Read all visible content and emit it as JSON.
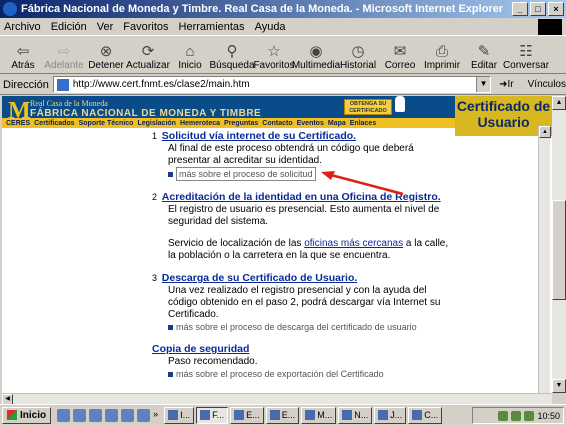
{
  "window": {
    "title": "Fábrica Nacional de Moneda y Timbre. Real Casa de la Moneda. - Microsoft Internet Explorer",
    "controls": [
      "_",
      "□",
      "×"
    ]
  },
  "menu": [
    "Archivo",
    "Edición",
    "Ver",
    "Favoritos",
    "Herramientas",
    "Ayuda"
  ],
  "toolbar": [
    {
      "label": "Atrás",
      "icon": "back-arrow-icon",
      "glyph": "⇦",
      "disabled": false
    },
    {
      "label": "Adelante",
      "icon": "forward-arrow-icon",
      "glyph": "⇨",
      "disabled": true
    },
    {
      "label": "Detener",
      "icon": "stop-icon",
      "glyph": "⊗",
      "disabled": false
    },
    {
      "label": "Actualizar",
      "icon": "refresh-icon",
      "glyph": "⟳",
      "disabled": false
    },
    {
      "label": "Inicio",
      "icon": "home-icon",
      "glyph": "⌂",
      "disabled": false
    },
    {
      "label": "Búsqueda",
      "icon": "search-icon",
      "glyph": "⚲",
      "disabled": false
    },
    {
      "label": "Favoritos",
      "icon": "favorites-icon",
      "glyph": "☆",
      "disabled": false
    },
    {
      "label": "Multimedia",
      "icon": "multimedia-icon",
      "glyph": "◉",
      "disabled": false
    },
    {
      "label": "Historial",
      "icon": "history-icon",
      "glyph": "◷",
      "disabled": false
    },
    {
      "label": "Correo",
      "icon": "mail-icon",
      "glyph": "✉",
      "disabled": false
    },
    {
      "label": "Imprimir",
      "icon": "print-icon",
      "glyph": "⎙",
      "disabled": false
    },
    {
      "label": "Editar",
      "icon": "edit-icon",
      "glyph": "✎",
      "disabled": false
    },
    {
      "label": "Conversar",
      "icon": "discuss-icon",
      "glyph": "☷",
      "disabled": false
    }
  ],
  "address": {
    "label": "Dirección",
    "url": "http://www.cert.fnmt.es/clase2/main.htm",
    "go_label": "Ir",
    "links_label": "Vínculos"
  },
  "banner": {
    "line1": "Real Casa de la Moneda",
    "line2": "FÁBRICA NACIONAL DE MONEDA Y TIMBRE",
    "obtain_button": "OBTENGA SU CERTIFICADO",
    "nav": [
      "CERES",
      "Certificados",
      "Soporte Técnico",
      "Legislación",
      "Hemeroteca",
      "Preguntas",
      "Contacto",
      "Eventos",
      "Mapa",
      "Enlaces"
    ],
    "cert_panel": "Certificado de Usuario"
  },
  "steps": {
    "s1": {
      "num": "1",
      "heading": "Solicitud vía internet de su Certificado.",
      "text": "Al final de este proceso obtendrá un código que deberá presentar al acreditar su identidad.",
      "more": "más sobre el proceso de solicitud"
    },
    "s2": {
      "num": "2",
      "heading": "Acreditación de la identidad en una Oficina de Registro.",
      "text": "El registro de usuario es presencial. Esto aumenta el nivel de seguridad del sistema.",
      "text2_before": "Servicio de localización de las ",
      "text2_link": "oficinas más cercanas",
      "text2_after": " a la calle, la población o la carretera en la que se encuentra."
    },
    "s3": {
      "num": "3",
      "heading": "Descarga de su Certificado de Usuario.",
      "text": "Una vez realizado el registro presencial y con la ayuda del código obtenido en el paso 2, podrá descargar vía Internet su Certificado.",
      "more": "más sobre el proceso de descarga del certificado de usuario"
    },
    "s4": {
      "heading": "Copia de seguridad",
      "text": "Paso recomendado.",
      "more": "más sobre el proceso de exportación del Certificado"
    }
  },
  "taskbar": {
    "start": "Inicio",
    "tasks": [
      "I...",
      "F...",
      "E...",
      "E...",
      "M...",
      "N...",
      "J...",
      "C..."
    ],
    "chevron": "»",
    "clock": "10:50"
  }
}
